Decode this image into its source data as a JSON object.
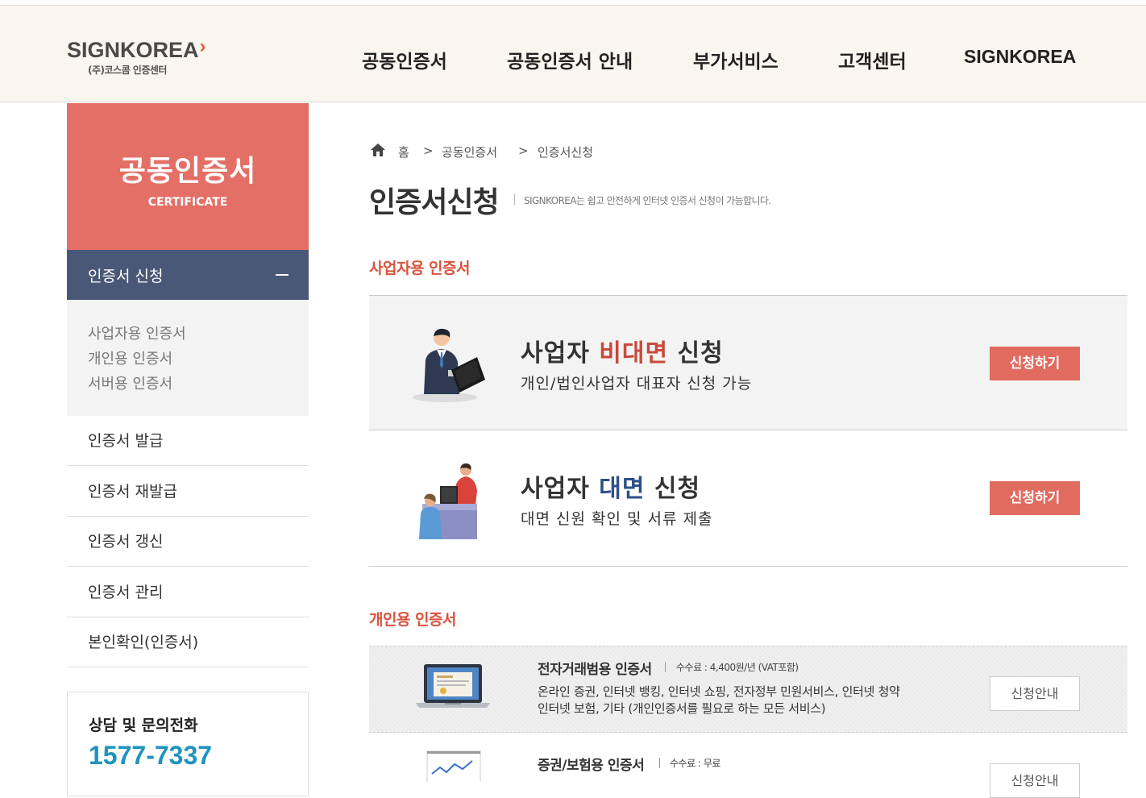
{
  "header": {
    "logo_text": "SIGNKOREA",
    "logo_sub": "(주)코스콤 인증센터",
    "nav": [
      {
        "label": "공동인증서"
      },
      {
        "label": "공동인증서 안내"
      },
      {
        "label": "부가서비스"
      },
      {
        "label": "고객센터"
      },
      {
        "label": "SIGNKOREA"
      }
    ]
  },
  "sidebar": {
    "hero_title": "공동인증서",
    "hero_sub": "CERTIFICATE",
    "active_menu": "인증서 신청",
    "sub_items": [
      "사업자용 인증서",
      "개인용 인증서",
      "서버용 인증서"
    ],
    "menu": [
      "인증서 발급",
      "인증서 재발급",
      "인증서 갱신",
      "인증서 관리",
      "본인확인(인증서)"
    ],
    "contact_title": "상담 및 문의전화",
    "contact_phone": "1577-7337"
  },
  "breadcrumb": {
    "home": "홈",
    "sep": ">",
    "level1": "공동인증서",
    "level2": "인증서신청"
  },
  "page": {
    "title": "인증서신청",
    "description": "SIGNKOREA는 쉽고 안전하게 인터넷 인증서 신청이 가능합니다."
  },
  "business": {
    "section_title": "사업자용 인증서",
    "cards": [
      {
        "title_pre": "사업자 ",
        "title_hl": "비대면",
        "title_post": " 신청",
        "desc": "개인/법인사업자 대표자 신청 가능",
        "button": "신청하기"
      },
      {
        "title_pre": "사업자 ",
        "title_hl": "대면",
        "title_post": " 신청",
        "desc": "대면 신원 확인 및 서류 제출",
        "button": "신청하기"
      }
    ]
  },
  "personal": {
    "section_title": "개인용 인증서",
    "rows": [
      {
        "title": "전자거래범용 인증서",
        "fee": "수수료 : 4,400원/년 (VAT포함)",
        "desc1": "온라인 증권, 인터넷 뱅킹, 인터넷 쇼핑, 전자정부 민원서비스, 인터넷 청약",
        "desc2": "인터넷 보험, 기타 (개인인증서를 필요로 하는 모든 서비스)",
        "button": "신청안내"
      },
      {
        "title": "증권/보험용 인증서",
        "fee": "수수료 : 무료",
        "button": "신청안내"
      }
    ]
  },
  "colors": {
    "accent_red": "#e46f66",
    "nav_active": "#4a5878",
    "section_title": "#d9533d",
    "phone": "#1e94bf",
    "highlight_blue": "#2c4f8a"
  }
}
